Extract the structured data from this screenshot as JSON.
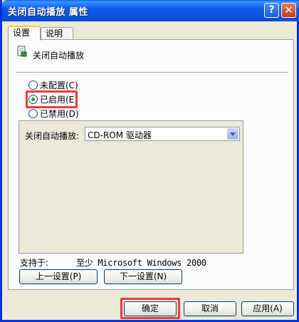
{
  "window": {
    "title": "关闭自动播放 属性",
    "help_label": "?",
    "close_label": "✕"
  },
  "tabs": [
    {
      "label": "设置",
      "active": true
    },
    {
      "label": "说明",
      "active": false
    }
  ],
  "policy": {
    "title": "关闭自动播放",
    "icon": "policy-scroll-icon"
  },
  "radios": [
    {
      "label": "未配置(C)",
      "checked": false
    },
    {
      "label": "已启用(E)",
      "checked": true
    },
    {
      "label": "已禁用(D)",
      "checked": false
    }
  ],
  "options": {
    "label": "关闭自动播放:",
    "select_value": "CD-ROM 驱动器"
  },
  "supported": {
    "label": "支持于:",
    "value": "至少 Microsoft Windows 2000"
  },
  "nav": {
    "prev_label": "上一设置(P)",
    "next_label": "下一设置(N)"
  },
  "footer": {
    "ok_label": "确定",
    "cancel_label": "取消",
    "apply_label": "应用(A)"
  },
  "colors": {
    "highlight": "#ee3b3b",
    "titlebar": "#0a5ef5",
    "radio_dot": "#21a121"
  }
}
